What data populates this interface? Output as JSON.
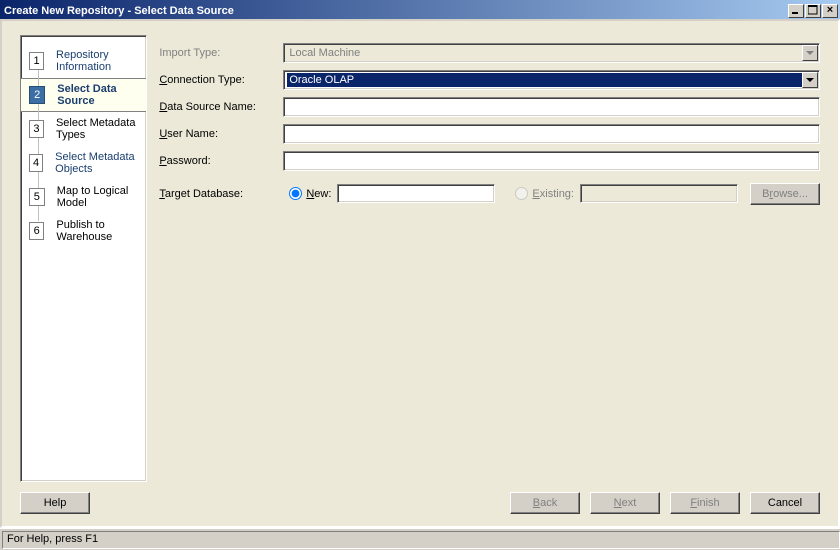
{
  "title": "Create New Repository - Select Data Source",
  "titlebar_buttons": {
    "min": "_",
    "max": "□",
    "close": "×"
  },
  "steps": [
    {
      "num": "1",
      "label": "Repository Information"
    },
    {
      "num": "2",
      "label": "Select Data Source"
    },
    {
      "num": "3",
      "label": "Select Metadata Types"
    },
    {
      "num": "4",
      "label": "Select Metadata Objects"
    },
    {
      "num": "5",
      "label": "Map to Logical Model"
    },
    {
      "num": "6",
      "label": "Publish to Warehouse"
    }
  ],
  "form": {
    "import_type_label": "Import Type:",
    "import_type_value": "Local Machine",
    "connection_type_label": "Connection Type:",
    "connection_type_value": "Oracle OLAP",
    "connection_type_mnemonic": "C",
    "data_source_label": "Data Source Name:",
    "data_source_mnemonic": "D",
    "data_source_value": "",
    "user_label": "User Name:",
    "user_mnemonic": "U",
    "user_value": "",
    "password_label": "Password:",
    "password_mnemonic": "P",
    "password_value": "",
    "target_label": "Target Database:",
    "target_mnemonic": "T",
    "new_label": "New:",
    "new_mnemonic": "N",
    "new_value": "",
    "existing_label": "Existing:",
    "existing_mnemonic": "E",
    "existing_value": "",
    "browse_label": "Browse...",
    "browse_mnemonic": "r"
  },
  "buttons": {
    "help": "Help",
    "back": "Back",
    "next": "Next",
    "finish": "Finish",
    "cancel": "Cancel"
  },
  "status": "For Help, press F1"
}
